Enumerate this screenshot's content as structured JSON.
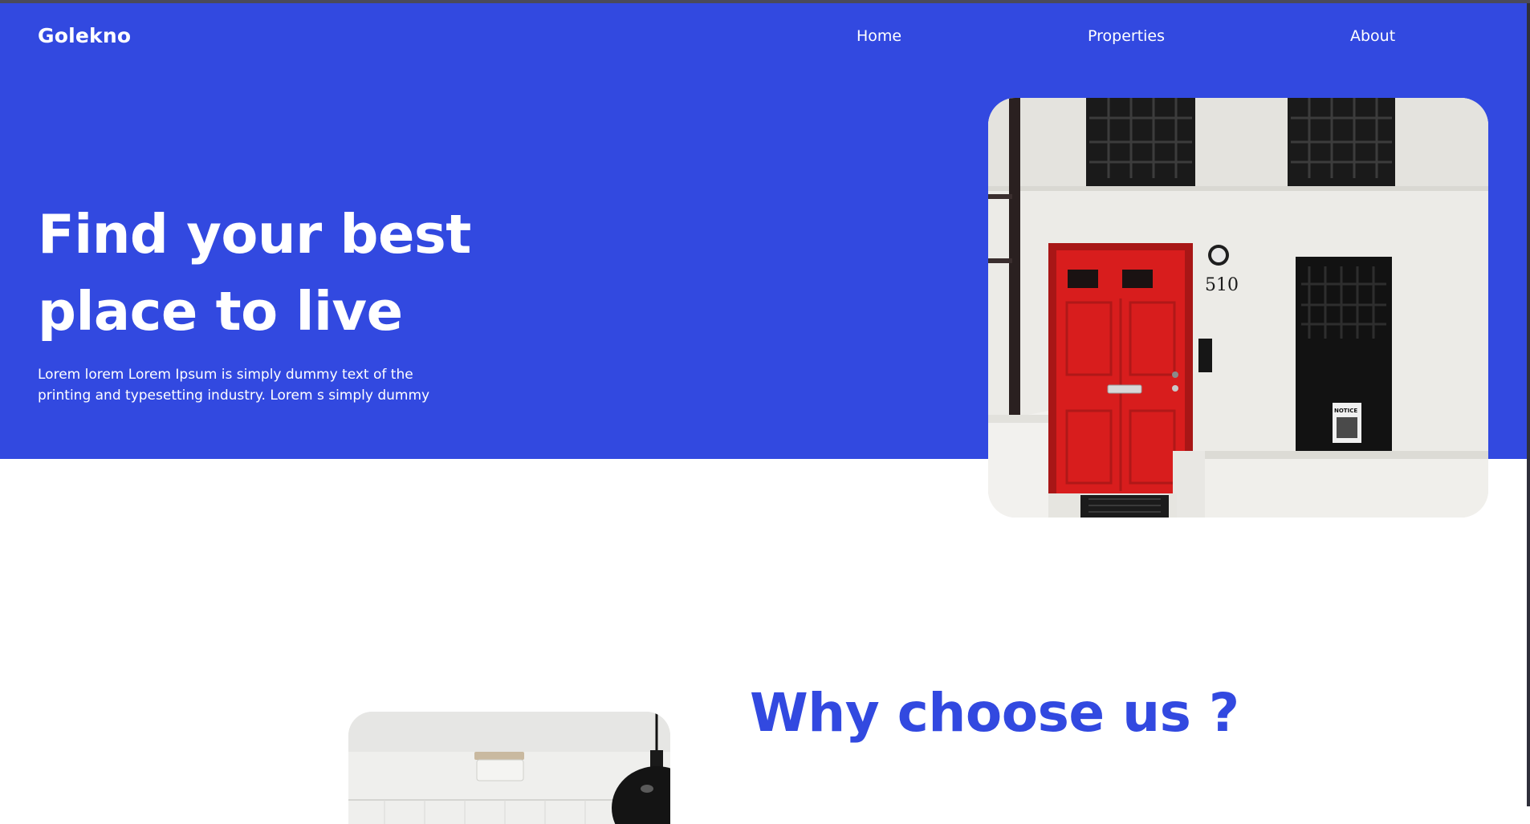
{
  "brand": {
    "name": "Golekno"
  },
  "nav": {
    "items": [
      {
        "label": "Home"
      },
      {
        "label": "Properties"
      },
      {
        "label": "About"
      }
    ]
  },
  "hero": {
    "headline": "Find your best place to live",
    "tagline": "Lorem lorem Lorem Ipsum is simply dummy text of the printing and typesetting industry. Lorem s simply dummy",
    "photo": {
      "house_number": "510",
      "sign_text": "NOTICE"
    }
  },
  "why": {
    "title": "Why choose us ?"
  },
  "colors": {
    "primary": "#3249e0",
    "text_on_primary": "#ffffff",
    "door_red": "#d81d1d",
    "wall": "#ebeae6"
  }
}
